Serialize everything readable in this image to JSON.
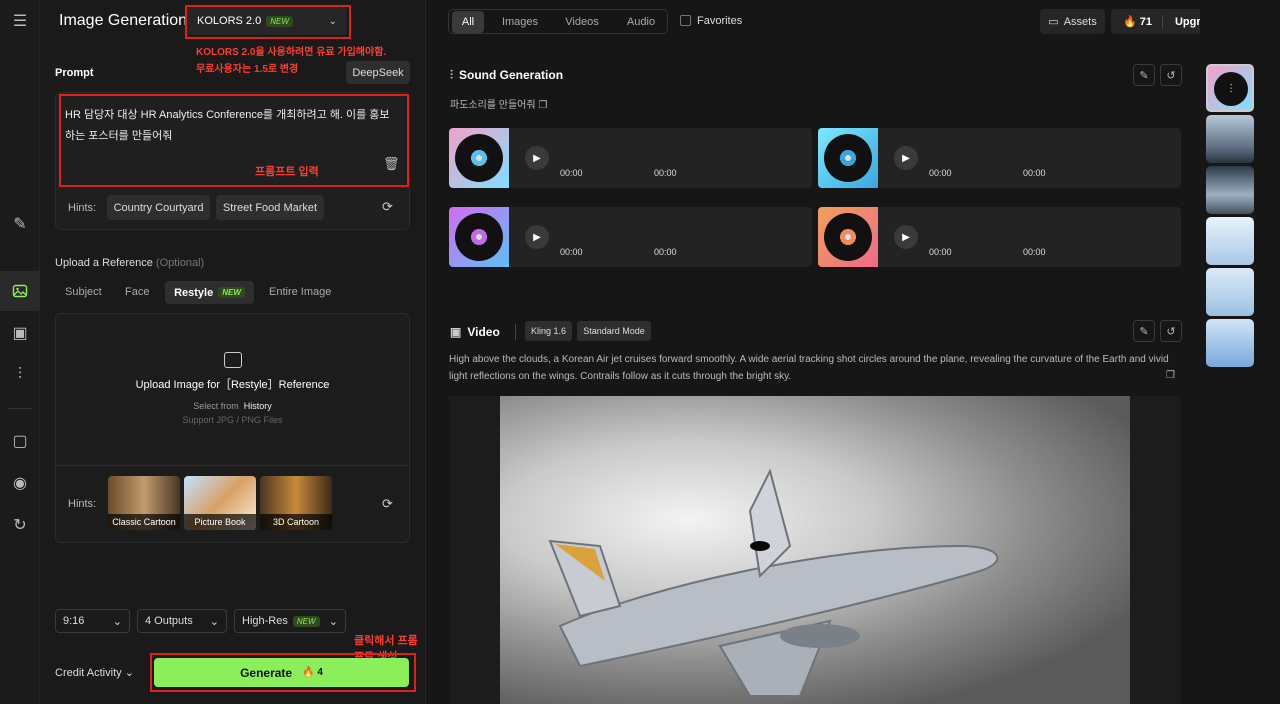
{
  "header": {
    "title": "Image Generation",
    "model": "KOLORS 2.0",
    "model_badge": "NEW",
    "annotation_model": "KOLORS 2.0을 사용하려면 유료 가입해야함.\n무료사용자는 1.5로 변경"
  },
  "prompt": {
    "label": "Prompt",
    "assistant_button": "DeepSeek",
    "text": "HR 담당자 대상 HR Analytics Conference를 개최하려고 해. 이를 홍보하는 포스터를 만들어줘",
    "annotation": "프롬프트 입력",
    "hints_label": "Hints:",
    "hints": [
      "Country Courtyard",
      "Street Food Market"
    ]
  },
  "reference": {
    "label": "Upload a Reference",
    "optional": "(Optional)",
    "tabs": [
      "Subject",
      "Face",
      "Restyle",
      "Entire Image"
    ],
    "active_tab_badge": "NEW",
    "upload_text": "Upload Image for［Restyle］Reference",
    "select_from": "Select from",
    "history": "History",
    "support": "Support JPG / PNG Files",
    "hints_label": "Hints:",
    "style_hints": [
      "Classic Cartoon",
      "Picture Book",
      "3D Cartoon"
    ]
  },
  "options": {
    "ratio": "9:16",
    "outputs": "4 Outputs",
    "quality": "High-Res",
    "quality_badge": "NEW"
  },
  "footer": {
    "credit_activity": "Credit Activity",
    "generate": "Generate",
    "cost": "4",
    "annotation": "클릭해서 프롬프트 생성"
  },
  "topbar": {
    "tabs": [
      "All",
      "Images",
      "Videos",
      "Audio"
    ],
    "favorites": "Favorites",
    "assets": "Assets",
    "credits": "71",
    "upgrade": "Upgrade Plan"
  },
  "sound": {
    "title": "Sound Generation",
    "prompt": "파도소리를 만들어줘",
    "tracks": [
      {
        "t1": "00:00",
        "t2": "00:00",
        "color": "#5bc0e8"
      },
      {
        "t1": "00:00",
        "t2": "00:00",
        "color": "#39a6e0"
      },
      {
        "t1": "00:00",
        "t2": "00:00",
        "color": "#c06be8"
      },
      {
        "t1": "00:00",
        "t2": "00:00",
        "color": "#f08a5a"
      }
    ]
  },
  "video": {
    "title": "Video",
    "model": "Kling 1.6",
    "mode": "Standard Mode",
    "prompt": "High above the clouds, a Korean Air jet cruises forward smoothly. A wide aerial tracking shot circles around the plane, revealing the curvature of the Earth and vivid light reflections on the wings. Contrails follow as it cuts through the bright sky."
  },
  "colors": {
    "accent": "#8bef5c",
    "annotation": "#e02020"
  }
}
